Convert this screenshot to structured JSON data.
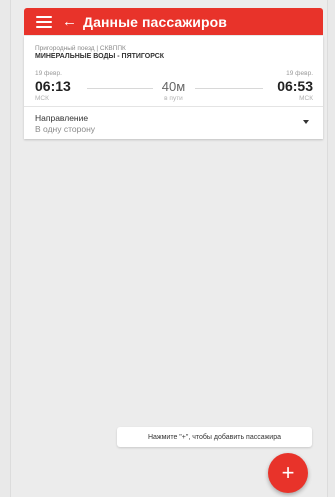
{
  "header": {
    "title": "Данные пассажиров",
    "menu_icon": "hamburger-menu-icon",
    "back_icon": "arrow-left-icon",
    "back_glyph": "←",
    "accent_color": "#e8332a"
  },
  "trip": {
    "train_type": "Пригородный поезд  |  СКВППК",
    "route": "МИНЕРАЛЬНЫЕ ВОДЫ - ПЯТИГОРСК",
    "departure": {
      "date": "19 февр.",
      "time": "06:13",
      "tz": "МСК"
    },
    "arrival": {
      "date": "19 февр.",
      "time": "06:53",
      "tz": "МСК"
    },
    "duration": "40м",
    "travel_label": "в пути"
  },
  "direction": {
    "label": "Направление",
    "value": "В одну сторону",
    "icon": "dropdown-arrow-icon"
  },
  "hint": {
    "text": "Нажмите \"+\", чтобы добавить пассажира"
  },
  "fab": {
    "label": "+",
    "icon": "plus-icon"
  }
}
